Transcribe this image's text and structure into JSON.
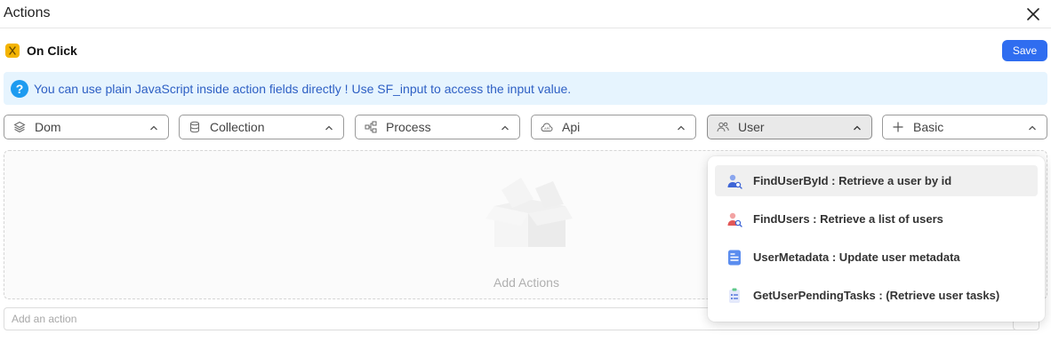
{
  "header": {
    "title": "Actions",
    "close_icon": "close-icon"
  },
  "event": {
    "label": "On Click",
    "icon": "event-icon",
    "icon_color": "#f4b400"
  },
  "toolbar": {
    "save_label": "Save",
    "save_color": "#2f6df0"
  },
  "info": {
    "text": "You can use plain JavaScript inside action fields directly ! Use SF_input to access the input value.",
    "icon": "question-icon",
    "background": "#e6f4fe",
    "text_color": "#2d5fc4"
  },
  "categories": [
    {
      "label": "Dom",
      "icon": "layers-icon",
      "open": false
    },
    {
      "label": "Collection",
      "icon": "database-icon",
      "open": false
    },
    {
      "label": "Process",
      "icon": "process-icon",
      "open": false
    },
    {
      "label": "Api",
      "icon": "cloud-api-icon",
      "open": false
    },
    {
      "label": "User",
      "icon": "users-icon",
      "open": true
    },
    {
      "label": "Basic",
      "icon": "plus-icon",
      "open": false
    }
  ],
  "empty_state": {
    "text": "Add Actions",
    "icon": "empty-box-icon"
  },
  "add_action": {
    "placeholder": "Add an action"
  },
  "user_menu": {
    "items": [
      {
        "label": "FindUserById : Retrieve a user by id",
        "icon": "user-search-icon",
        "highlighted": true
      },
      {
        "label": "FindUsers : Retrieve a list of users",
        "icon": "users-search-icon",
        "highlighted": false
      },
      {
        "label": "UserMetadata : Update user metadata",
        "icon": "document-icon",
        "highlighted": false
      },
      {
        "label": "GetUserPendingTasks : (Retrieve user tasks)",
        "icon": "task-list-icon",
        "highlighted": false
      }
    ]
  }
}
